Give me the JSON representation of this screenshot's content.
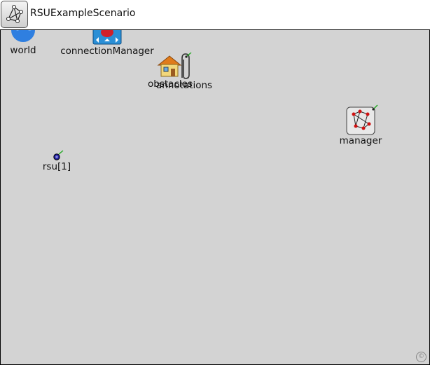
{
  "network": {
    "title": "RSUExampleScenario",
    "icon": "network-graph-icon"
  },
  "modules": [
    {
      "key": "world",
      "label": "world",
      "icon": "globe-icon"
    },
    {
      "key": "connectionManager",
      "label": "connectionManager",
      "icon": "connection-manager-icon"
    },
    {
      "key": "obstacles",
      "label": "obstacles",
      "icon": "house-icon"
    },
    {
      "key": "annotations",
      "label": "annotations",
      "icon": "paperclip-icon"
    },
    {
      "key": "manager",
      "label": "manager",
      "icon": "network-manager-icon"
    },
    {
      "key": "rsu",
      "label": "rsu[1]",
      "icon": "node-dot-icon"
    }
  ],
  "colors": {
    "canvas": "#d3d3d3",
    "globe": "#2f7fe0",
    "cm_box": "#2a8fd6",
    "manager_lines": "#d01010",
    "rsu_dot": "#2020a0",
    "marker": "#22aa22"
  }
}
